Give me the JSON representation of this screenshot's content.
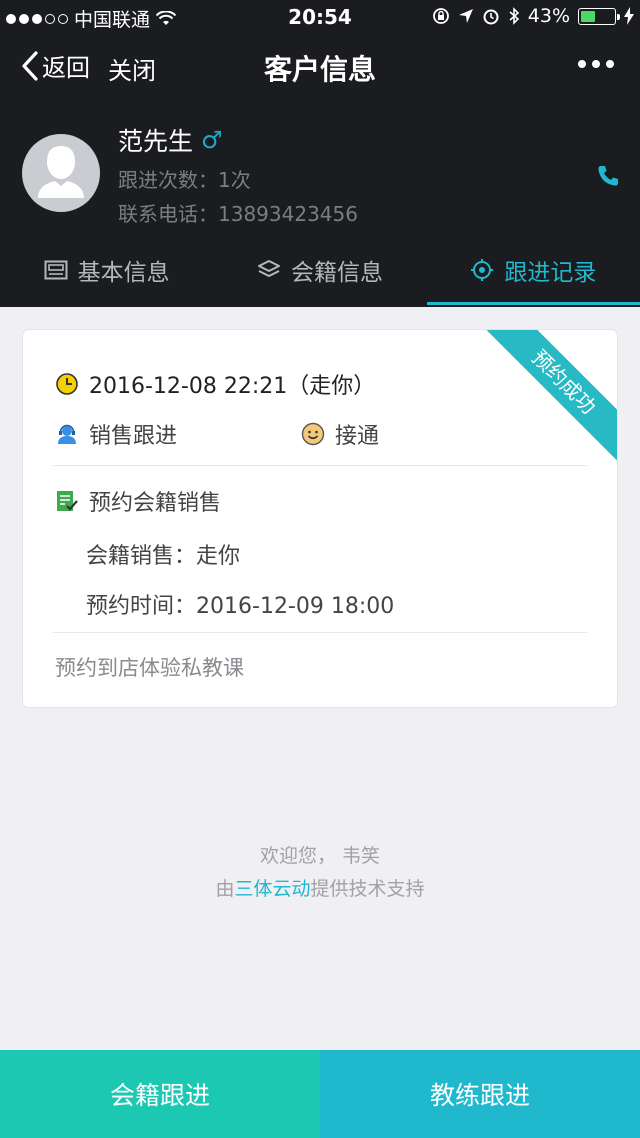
{
  "status_bar": {
    "carrier": "中国联通",
    "time": "20:54",
    "battery": "43%",
    "battery_level": 0.43
  },
  "nav": {
    "back_label": "返回",
    "close_label": "关闭",
    "title": "客户信息"
  },
  "customer": {
    "name": "范先生",
    "gender_symbol": "♂",
    "follow_count": "跟进次数：1次",
    "phone": "联系电话：13893423456"
  },
  "tabs": [
    {
      "label": "基本信息",
      "icon": "id-card-icon",
      "active": false
    },
    {
      "label": "会籍信息",
      "icon": "layers-icon",
      "active": false
    },
    {
      "label": "跟进记录",
      "icon": "target-icon",
      "active": true
    }
  ],
  "record": {
    "ribbon": "预约成功",
    "datetime": "2016-12-08 22:21（走你）",
    "follow_type": "销售跟进",
    "call_status": "接通",
    "appointment_title": "预约会籍销售",
    "sales_label": "会籍销售：",
    "sales_value": "走你",
    "time_label": "预约时间：",
    "time_value": "2016-12-09 18:00",
    "note": "预约到店体验私教课"
  },
  "footer": {
    "welcome": "欢迎您， 韦笑",
    "support_prefix": "由",
    "support_brand": "三体云动",
    "support_suffix": "提供技术支持"
  },
  "bottom_bar": {
    "left_label": "会籍跟进",
    "right_label": "教练跟进"
  },
  "colors": {
    "accent": "#1fb8cf",
    "header_bg": "#1b1c1f",
    "left_button": "#1dc8b3",
    "right_button": "#1fb8cc"
  }
}
